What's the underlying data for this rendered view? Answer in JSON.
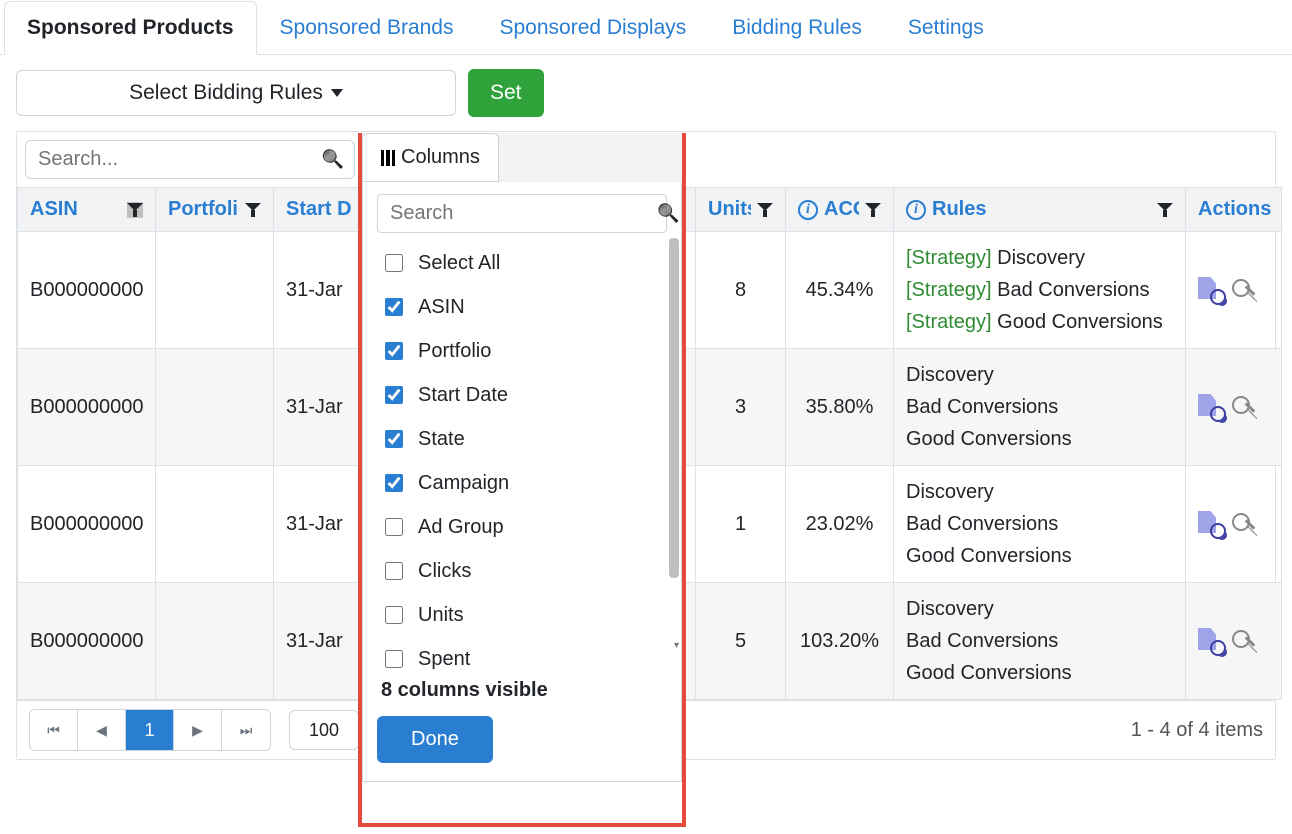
{
  "tabs": [
    {
      "label": "Sponsored Products",
      "active": true
    },
    {
      "label": "Sponsored Brands",
      "active": false
    },
    {
      "label": "Sponsored Displays",
      "active": false
    },
    {
      "label": "Bidding Rules",
      "active": false
    },
    {
      "label": "Settings",
      "active": false
    }
  ],
  "toolbar": {
    "select_rules_label": "Select Bidding Rules",
    "set_label": "Set",
    "search_placeholder": "Search..."
  },
  "columns_button_label": "Columns",
  "headers": {
    "asin": "ASIN",
    "portfolio": "Portfolio",
    "start_date": "Start D",
    "units": "Units",
    "acos": "ACOS",
    "rules": "Rules",
    "actions": "Actions"
  },
  "rows": [
    {
      "asin": "B000000000",
      "start_date": "31-Jar",
      "units": "8",
      "acos": "45.34%",
      "rules": [
        {
          "strategy": true,
          "label": "Discovery"
        },
        {
          "strategy": true,
          "label": "Bad Conversions"
        },
        {
          "strategy": true,
          "label": "Good Conversions"
        }
      ]
    },
    {
      "asin": "B000000000",
      "start_date": "31-Jar",
      "units": "3",
      "acos": "35.80%",
      "rules": [
        {
          "strategy": false,
          "label": "Discovery"
        },
        {
          "strategy": false,
          "label": "Bad Conversions"
        },
        {
          "strategy": false,
          "label": "Good Conversions"
        }
      ]
    },
    {
      "asin": "B000000000",
      "start_date": "31-Jar",
      "units": "1",
      "acos": "23.02%",
      "rules": [
        {
          "strategy": false,
          "label": "Discovery"
        },
        {
          "strategy": false,
          "label": "Bad Conversions"
        },
        {
          "strategy": false,
          "label": "Good Conversions"
        }
      ]
    },
    {
      "asin": "B000000000",
      "start_date": "31-Jar",
      "units": "5",
      "acos": "103.20%",
      "rules": [
        {
          "strategy": false,
          "label": "Discovery"
        },
        {
          "strategy": false,
          "label": "Bad Conversions"
        },
        {
          "strategy": false,
          "label": "Good Conversions"
        }
      ]
    }
  ],
  "pager": {
    "current_page": "1",
    "page_size": "100",
    "summary": "1 - 4 of 4 items"
  },
  "columns_popover": {
    "tab_label": "Columns",
    "search_placeholder": "Search",
    "items": [
      {
        "label": "Select All",
        "checked": false
      },
      {
        "label": "ASIN",
        "checked": true
      },
      {
        "label": "Portfolio",
        "checked": true
      },
      {
        "label": "Start Date",
        "checked": true
      },
      {
        "label": "State",
        "checked": true
      },
      {
        "label": "Campaign",
        "checked": true
      },
      {
        "label": "Ad Group",
        "checked": false
      },
      {
        "label": "Clicks",
        "checked": false
      },
      {
        "label": "Units",
        "checked": false
      },
      {
        "label": "Spent",
        "checked": false
      }
    ],
    "visible_text": "8 columns visible",
    "done_label": "Done"
  }
}
